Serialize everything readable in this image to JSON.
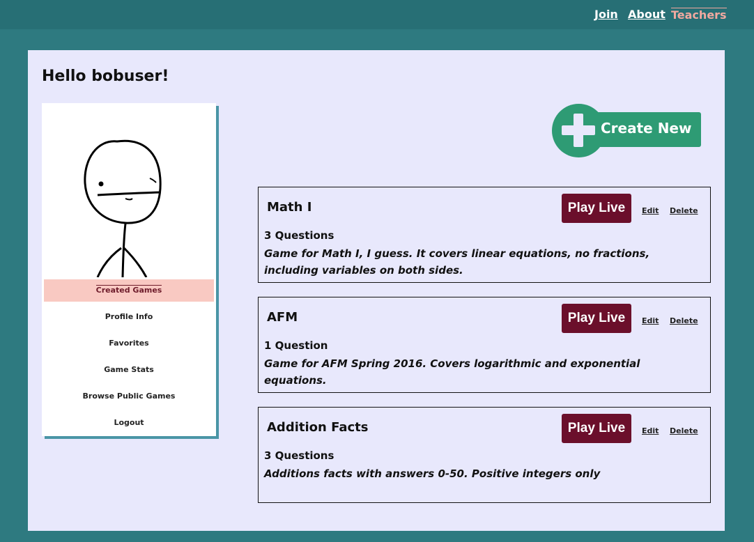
{
  "nav": {
    "join": "Join",
    "about": "About",
    "teachers": "Teachers"
  },
  "greeting": "Hello bobuser!",
  "sidebar": {
    "items": [
      {
        "label": "Created Games",
        "active": true
      },
      {
        "label": "Profile Info"
      },
      {
        "label": "Favorites"
      },
      {
        "label": "Game Stats"
      },
      {
        "label": "Browse Public Games"
      },
      {
        "label": "Logout"
      }
    ]
  },
  "create_button": {
    "label": "Create New"
  },
  "games": [
    {
      "title": "Math I",
      "play_label": "Play Live",
      "edit_label": "Edit",
      "delete_label": "Delete",
      "question_count": "3 Questions",
      "description": "Game for Math I, I guess. It covers linear equations, no fractions, including variables on both sides."
    },
    {
      "title": "AFM",
      "play_label": "Play Live",
      "edit_label": "Edit",
      "delete_label": "Delete",
      "question_count": "1 Question",
      "description": "Game for AFM Spring 2016. Covers logarithmic and exponential equations."
    },
    {
      "title": "Addition Facts",
      "play_label": "Play Live",
      "edit_label": "Edit",
      "delete_label": "Delete",
      "question_count": "3 Questions",
      "description": "Additions facts with answers 0-50. Positive integers only"
    }
  ],
  "colors": {
    "background": "#2e7a80",
    "topbar": "#276f75",
    "panel": "#e8e8fc",
    "play_button": "#6b0f2b",
    "create_button": "#2e9b74",
    "active_item": "#f9c9c2",
    "teachers_link": "#f1a9a0"
  },
  "icons": {
    "create": "plus-icon",
    "avatar": "stick-figure-avatar"
  }
}
